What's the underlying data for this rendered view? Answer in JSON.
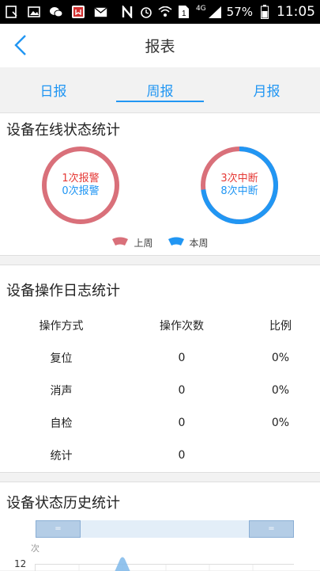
{
  "status_bar": {
    "network": "4G",
    "battery": "57%",
    "time": "11:05"
  },
  "nav": {
    "title": "报表"
  },
  "tabs": [
    {
      "label": "日报"
    },
    {
      "label": "周报",
      "active": true
    },
    {
      "label": "月报"
    }
  ],
  "online_stats": {
    "title": "设备在线状态统计",
    "left_ring": {
      "line1": "1次报警",
      "line2": "0次报警",
      "this_week_fraction": 0.0
    },
    "right_ring": {
      "line1": "3次中断",
      "line2": "8次中断",
      "this_week_fraction": 0.73
    },
    "legend": {
      "last_week": "上周",
      "this_week": "本周"
    },
    "colors": {
      "last_week": "#d9707a",
      "this_week": "#2196f3"
    }
  },
  "ops_log": {
    "title": "设备操作日志统计",
    "headers": [
      "操作方式",
      "操作次数",
      "比例"
    ],
    "rows": [
      [
        "复位",
        "0",
        "0%"
      ],
      [
        "消声",
        "0",
        "0%"
      ],
      [
        "自检",
        "0",
        "0%"
      ],
      [
        "统计",
        "0",
        ""
      ]
    ]
  },
  "history": {
    "title": "设备状态历史统计",
    "y_unit": "次",
    "y_tick": "12",
    "slider_handle_left": "=",
    "slider_handle_right": "="
  }
}
